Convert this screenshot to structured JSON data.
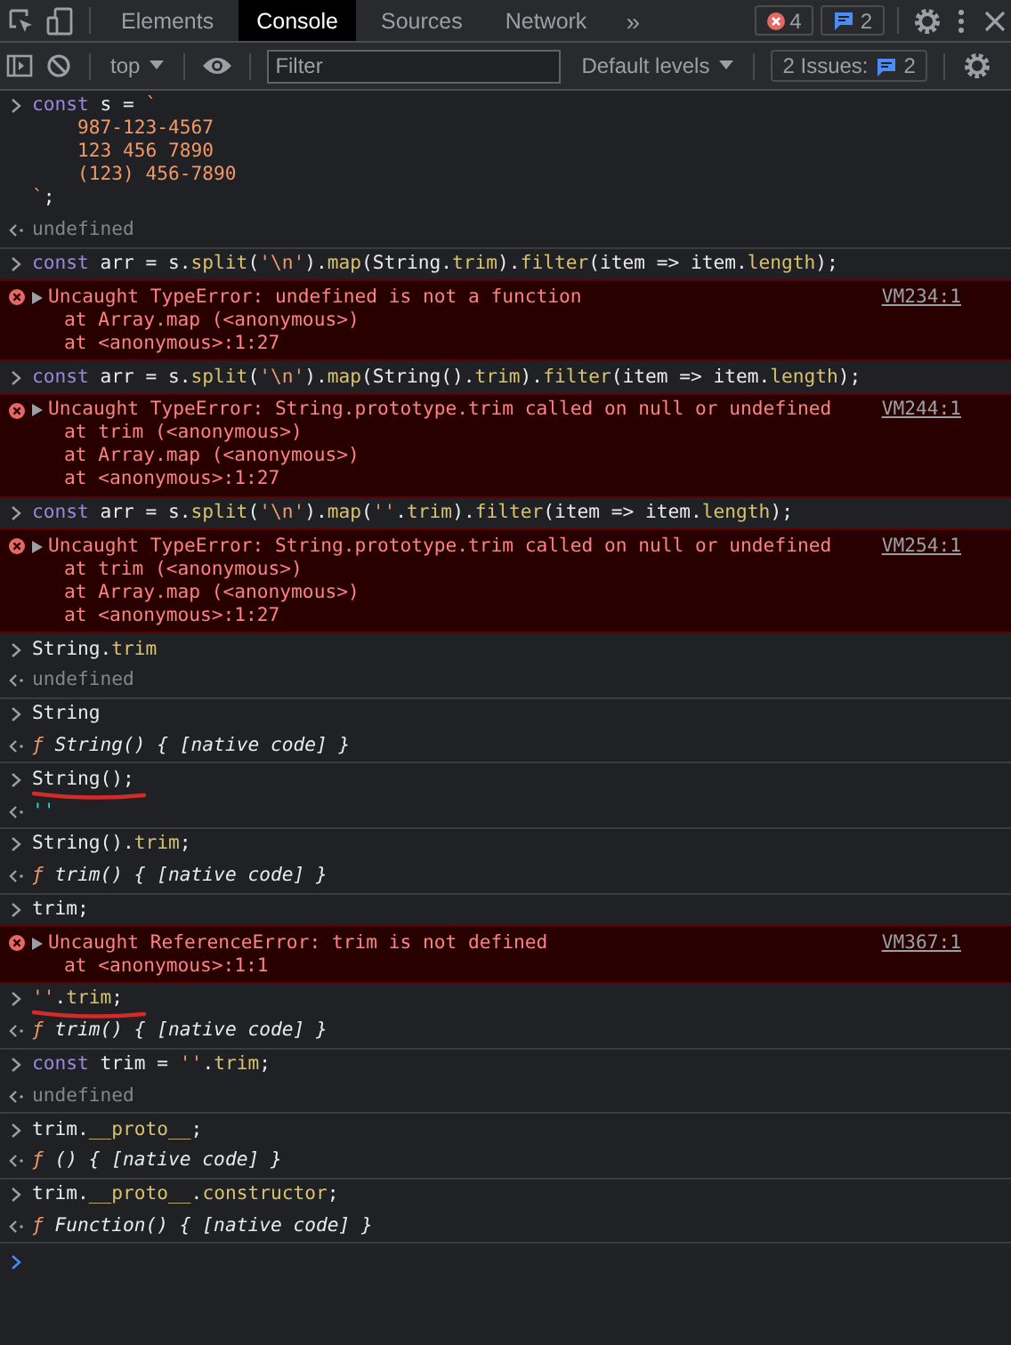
{
  "tabs": [
    {
      "label": "Elements",
      "selected": false
    },
    {
      "label": "Console",
      "selected": true
    },
    {
      "label": "Sources",
      "selected": false
    },
    {
      "label": "Network",
      "selected": false
    }
  ],
  "more_tabs": "»",
  "error_count": "4",
  "message_count": "2",
  "toolbar": {
    "context": "top",
    "filter_placeholder": "Filter",
    "levels": "Default levels",
    "issues_label": "2 Issues:",
    "issues_count": "2"
  },
  "entries": [
    {
      "kind": "input",
      "underlined": false,
      "lines": [
        [
          {
            "kind": "kw",
            "text": "const"
          },
          {
            "kind": "plain",
            "text": " s = "
          },
          {
            "kind": "str",
            "text": "`"
          }
        ],
        [
          {
            "kind": "str",
            "text": "    987-123-4567"
          }
        ],
        [
          {
            "kind": "str",
            "text": "    123 456 7890"
          }
        ],
        [
          {
            "kind": "str",
            "text": "    (123) 456-7890"
          }
        ],
        [
          {
            "kind": "str",
            "text": "`"
          },
          {
            "kind": "plain",
            "text": ";"
          }
        ]
      ]
    },
    {
      "kind": "output",
      "tokens": [
        {
          "kind": "undef",
          "text": "undefined"
        }
      ]
    },
    {
      "kind": "input",
      "underlined": false,
      "lines": [
        [
          {
            "kind": "kw",
            "text": "const"
          },
          {
            "kind": "plain",
            "text": " arr = s."
          },
          {
            "kind": "prop",
            "text": "split"
          },
          {
            "kind": "plain",
            "text": "("
          },
          {
            "kind": "str",
            "text": "'\\n'"
          },
          {
            "kind": "plain",
            "text": ")."
          },
          {
            "kind": "prop",
            "text": "map"
          },
          {
            "kind": "plain",
            "text": "(String."
          },
          {
            "kind": "prop",
            "text": "trim"
          },
          {
            "kind": "plain",
            "text": ")."
          },
          {
            "kind": "prop",
            "text": "filter"
          },
          {
            "kind": "plain",
            "text": "(item => item."
          },
          {
            "kind": "prop",
            "text": "length"
          },
          {
            "kind": "plain",
            "text": ");"
          }
        ]
      ]
    },
    {
      "kind": "error",
      "expanded": false,
      "message": "Uncaught TypeError: undefined is not a function",
      "source": "VM234:1",
      "stack": [
        "at Array.map (<anonymous>)",
        "at <anonymous>:1:27"
      ]
    },
    {
      "kind": "input",
      "underlined": false,
      "lines": [
        [
          {
            "kind": "kw",
            "text": "const"
          },
          {
            "kind": "plain",
            "text": " arr = s."
          },
          {
            "kind": "prop",
            "text": "split"
          },
          {
            "kind": "plain",
            "text": "("
          },
          {
            "kind": "str",
            "text": "'\\n'"
          },
          {
            "kind": "plain",
            "text": ")."
          },
          {
            "kind": "prop",
            "text": "map"
          },
          {
            "kind": "plain",
            "text": "(String()."
          },
          {
            "kind": "prop",
            "text": "trim"
          },
          {
            "kind": "plain",
            "text": ")."
          },
          {
            "kind": "prop",
            "text": "filter"
          },
          {
            "kind": "plain",
            "text": "(item => item."
          },
          {
            "kind": "prop",
            "text": "length"
          },
          {
            "kind": "plain",
            "text": ");"
          }
        ]
      ]
    },
    {
      "kind": "error",
      "expanded": false,
      "message": "Uncaught TypeError: String.prototype.trim called on null or undefined",
      "source": "VM244:1",
      "stack": [
        "at trim (<anonymous>)",
        "at Array.map (<anonymous>)",
        "at <anonymous>:1:27"
      ]
    },
    {
      "kind": "input",
      "underlined": false,
      "lines": [
        [
          {
            "kind": "kw",
            "text": "const"
          },
          {
            "kind": "plain",
            "text": " arr = s."
          },
          {
            "kind": "prop",
            "text": "split"
          },
          {
            "kind": "plain",
            "text": "("
          },
          {
            "kind": "str",
            "text": "'\\n'"
          },
          {
            "kind": "plain",
            "text": ")."
          },
          {
            "kind": "prop",
            "text": "map"
          },
          {
            "kind": "plain",
            "text": "("
          },
          {
            "kind": "str",
            "text": "''"
          },
          {
            "kind": "plain",
            "text": "."
          },
          {
            "kind": "prop",
            "text": "trim"
          },
          {
            "kind": "plain",
            "text": ")."
          },
          {
            "kind": "prop",
            "text": "filter"
          },
          {
            "kind": "plain",
            "text": "(item => item."
          },
          {
            "kind": "prop",
            "text": "length"
          },
          {
            "kind": "plain",
            "text": ");"
          }
        ]
      ]
    },
    {
      "kind": "error",
      "expanded": false,
      "message": "Uncaught TypeError: String.prototype.trim called on null or undefined",
      "source": "VM254:1",
      "stack": [
        "at trim (<anonymous>)",
        "at Array.map (<anonymous>)",
        "at <anonymous>:1:27"
      ]
    },
    {
      "kind": "input",
      "underlined": false,
      "lines": [
        [
          {
            "kind": "plain",
            "text": "String."
          },
          {
            "kind": "prop",
            "text": "trim"
          }
        ]
      ]
    },
    {
      "kind": "output",
      "tokens": [
        {
          "kind": "undef",
          "text": "undefined"
        }
      ]
    },
    {
      "kind": "input",
      "underlined": false,
      "lines": [
        [
          {
            "kind": "plain",
            "text": "String"
          }
        ]
      ]
    },
    {
      "kind": "output",
      "tokens": [
        {
          "kind": "fn",
          "text": "ƒ"
        },
        {
          "kind": "sig",
          "text": " String() { [native code] }"
        }
      ]
    },
    {
      "kind": "input",
      "underlined": true,
      "lines": [
        [
          {
            "kind": "plain",
            "text": "String();"
          }
        ]
      ]
    },
    {
      "kind": "output",
      "tokens": [
        {
          "kind": "strval",
          "text": "''"
        }
      ]
    },
    {
      "kind": "input",
      "underlined": false,
      "lines": [
        [
          {
            "kind": "plain",
            "text": "String()."
          },
          {
            "kind": "prop",
            "text": "trim"
          },
          {
            "kind": "plain",
            "text": ";"
          }
        ]
      ]
    },
    {
      "kind": "output",
      "tokens": [
        {
          "kind": "fn",
          "text": "ƒ"
        },
        {
          "kind": "sig",
          "text": " trim() { [native code] }"
        }
      ]
    },
    {
      "kind": "input",
      "underlined": false,
      "lines": [
        [
          {
            "kind": "plain",
            "text": "trim;"
          }
        ]
      ]
    },
    {
      "kind": "error",
      "expanded": false,
      "message": "Uncaught ReferenceError: trim is not defined",
      "source": "VM367:1",
      "stack": [
        "at <anonymous>:1:1"
      ]
    },
    {
      "kind": "input",
      "underlined": true,
      "lines": [
        [
          {
            "kind": "str",
            "text": "''"
          },
          {
            "kind": "plain",
            "text": "."
          },
          {
            "kind": "prop",
            "text": "trim"
          },
          {
            "kind": "plain",
            "text": ";"
          }
        ]
      ]
    },
    {
      "kind": "output",
      "tokens": [
        {
          "kind": "fn",
          "text": "ƒ"
        },
        {
          "kind": "sig",
          "text": " trim() { [native code] }"
        }
      ]
    },
    {
      "kind": "input",
      "underlined": false,
      "lines": [
        [
          {
            "kind": "kw",
            "text": "const"
          },
          {
            "kind": "plain",
            "text": " trim = "
          },
          {
            "kind": "str",
            "text": "''"
          },
          {
            "kind": "plain",
            "text": "."
          },
          {
            "kind": "prop",
            "text": "trim"
          },
          {
            "kind": "plain",
            "text": ";"
          }
        ]
      ]
    },
    {
      "kind": "output",
      "tokens": [
        {
          "kind": "undef",
          "text": "undefined"
        }
      ]
    },
    {
      "kind": "input",
      "underlined": false,
      "lines": [
        [
          {
            "kind": "plain",
            "text": "trim."
          },
          {
            "kind": "prop",
            "text": "__proto__"
          },
          {
            "kind": "plain",
            "text": ";"
          }
        ]
      ]
    },
    {
      "kind": "output",
      "tokens": [
        {
          "kind": "fn",
          "text": "ƒ"
        },
        {
          "kind": "sig",
          "text": " () { [native code] }"
        }
      ]
    },
    {
      "kind": "input",
      "underlined": false,
      "lines": [
        [
          {
            "kind": "plain",
            "text": "trim."
          },
          {
            "kind": "prop",
            "text": "__proto__"
          },
          {
            "kind": "plain",
            "text": "."
          },
          {
            "kind": "prop",
            "text": "constructor"
          },
          {
            "kind": "plain",
            "text": ";"
          }
        ]
      ]
    },
    {
      "kind": "output",
      "tokens": [
        {
          "kind": "fn",
          "text": "ƒ"
        },
        {
          "kind": "sig",
          "text": " Function() { [native code] }"
        }
      ]
    }
  ]
}
